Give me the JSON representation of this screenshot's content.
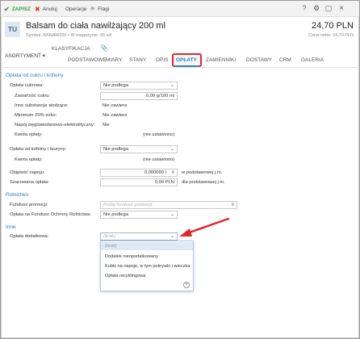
{
  "toolbar": {
    "save": "ZAPISZ",
    "cancel": "Anuluj",
    "operations": "Operacje",
    "flags": "Flagi"
  },
  "header": {
    "badge": "TU",
    "title": "Balsam do ciała nawilżający 200 ml",
    "subtitle": "Symbol: BANAW200  •  W magazynie: 96 szt",
    "price": "24,70 PLN",
    "price_net": "Cena netto: 24,70 PLN"
  },
  "tabs": {
    "assortment": "ASORTYMENT",
    "classification": "KLASYFIKACJA",
    "items": [
      "PODSTAWOWE",
      "MIARY",
      "STANY",
      "OPIS",
      "OPŁATY",
      "ZAMIENNIKI",
      "DOSTAWY",
      "CRM",
      "GALERIA"
    ],
    "active": "OPŁATY"
  },
  "sections": {
    "sugar": "Opłata od cukru i kofeiny",
    "agri": "Rolnictwo",
    "other": "Inne"
  },
  "form": {
    "sugar_fee_label": "Opłata cukrowa:",
    "sugar_fee_value": "Nie podlega",
    "sugar_content_label": "Zawartość cukru:",
    "sugar_content_value": "0,00 g/100 ml",
    "other_sweet_label": "Inne substancje słodzące:",
    "other_sweet_value": "Nie zawiera",
    "min_juice_label": "Minimum 20% soku:",
    "min_juice_value": "Nie zawiera",
    "carb_drink_label": "Napój węglowodanowo-elektrolityczny:",
    "carb_drink_value": "Nie",
    "fee_amount_label": "Kwota opłaty:",
    "fee_amount_value": "(nie ustawiono)",
    "caffeine_fee_label": "Opłata od kofeiny i tauryny:",
    "caffeine_fee_value": "Nie podlega",
    "caffeine_amount_label": "Kwota opłaty:",
    "caffeine_amount_value": "(nie ustawiono)",
    "volume_label": "Objętość napoju:",
    "volume_value": "0,000000 l",
    "volume_unit": "w podstawowej j.m.",
    "est_fee_label": "Szacowana opłata:",
    "est_fee_value": "0,00 PLN",
    "est_fee_unit": "dla podstawowej j.m.",
    "promo_fund_label": "Fundusz promocji:",
    "promo_fund_placeholder": "Podaj fundusz promocji",
    "agri_fund_label": "Opłata na Fundusz Ochrony Rolnictwa:",
    "agri_fund_value": "Nie podlega",
    "extra_fee_label": "Opłata dodatkowa:",
    "extra_fee_value": "(brak)"
  },
  "dropdown": {
    "options": [
      "(brak)",
      "Dodatek nieopodatkowany",
      "Kubki na napoje, w tym pokrywki i wieczka",
      "Opłata recyklingowa"
    ]
  },
  "colors": {
    "accent": "#2f7fc1",
    "highlight": "#e2262e",
    "save_green": "#3a9a3a"
  }
}
